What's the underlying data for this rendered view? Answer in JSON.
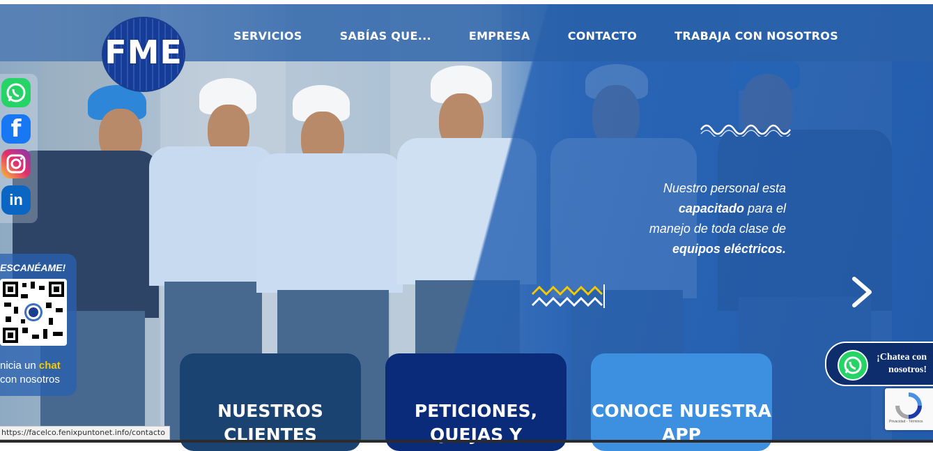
{
  "nav": {
    "logo_text": "FME",
    "items": [
      "SERVICIOS",
      "SABÍAS QUE...",
      "EMPRESA",
      "CONTACTO",
      "TRABAJA CON NOSOTROS"
    ]
  },
  "social": {
    "icons": [
      "whatsapp-icon",
      "facebook-icon",
      "instagram-icon",
      "linkedin-icon"
    ],
    "linkedin_label": "in",
    "facebook_label": "f"
  },
  "qr": {
    "title": "ESCANÉAME!",
    "line1_prefix": "nicia un ",
    "line1_highlight": "chat",
    "line2": "con nosotros"
  },
  "slide": {
    "line1": "Nuestro personal esta",
    "line2_bold": "capacitado",
    "line2_rest": " para el",
    "line3": "manejo de toda clase de",
    "line4_bold": "equipos eléctricos."
  },
  "cards": [
    {
      "label": "NUESTROS CLIENTES",
      "color": "#1a4372"
    },
    {
      "label": "PETICIONES, QUEJAS Y",
      "color": "#0a2a7a"
    },
    {
      "label": "CONOCE NUESTRA APP",
      "color": "#3d8fe0"
    }
  ],
  "chat": {
    "line1": "¡Chatea con",
    "line2": "nosotros!"
  },
  "recaptcha": {
    "text": "Privacidad - Términos"
  },
  "status_url": "https://facelco.fenixpuntonet.info/contacto",
  "colors": {
    "brand_blue": "#1a3e90",
    "overlay_blue": "#2662b4",
    "whatsapp_green": "#25d366",
    "highlight_yellow": "#f5c800"
  }
}
